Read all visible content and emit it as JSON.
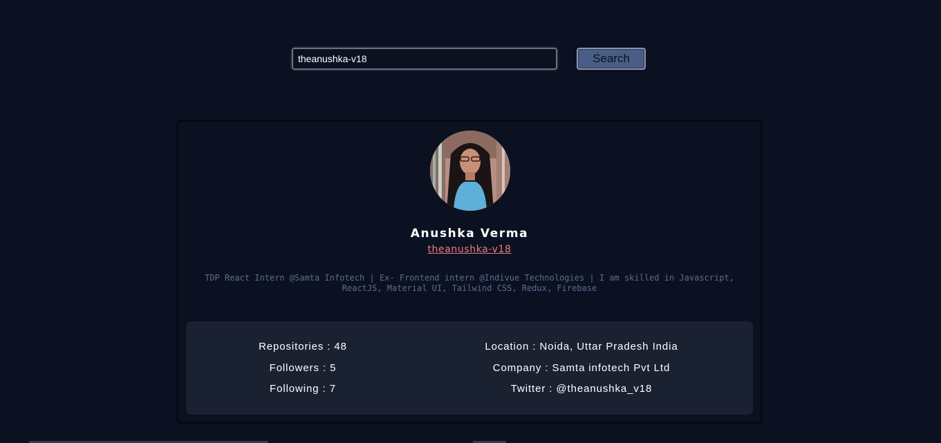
{
  "search": {
    "value": "theanushka-v18",
    "button_label": "Search"
  },
  "profile": {
    "name": "Anushka Verma",
    "login": "theanushka-v18",
    "bio": "TDP React Intern @Samta Infotech | Ex- Frontend intern @Indivue Technologies | I am skilled in Javascript, ReactJS, Material UI, Tailwind CSS, Redux, Firebase"
  },
  "stats": {
    "repositories": "Repositories : 48",
    "followers": "Followers : 5",
    "following": "Following : 7",
    "location": "Location : Noida, Uttar Pradesh India",
    "company": "Company : Samta infotech Pvt Ltd",
    "twitter": "Twitter : @theanushka_v18"
  },
  "colors": {
    "background": "#0b1120",
    "panel": "#1a2232",
    "button": "#4a5d86",
    "link": "#f27a86",
    "bio_text": "#5a6d93"
  },
  "icons": {
    "avatar": "user-avatar-photo"
  }
}
